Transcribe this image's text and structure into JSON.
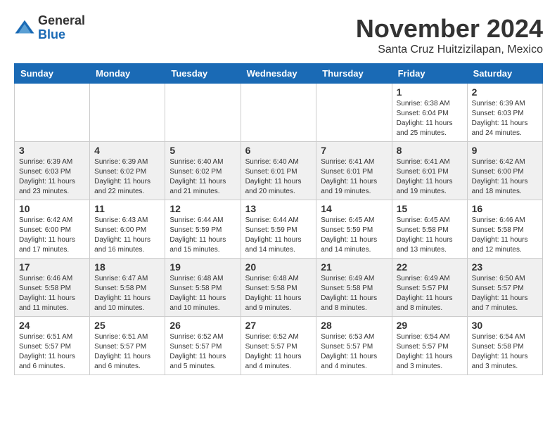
{
  "header": {
    "logo": {
      "general": "General",
      "blue": "Blue"
    },
    "month_year": "November 2024",
    "location": "Santa Cruz Huitzizilapan, Mexico"
  },
  "weekdays": [
    "Sunday",
    "Monday",
    "Tuesday",
    "Wednesday",
    "Thursday",
    "Friday",
    "Saturday"
  ],
  "weeks": [
    {
      "row_class": "week-row-1",
      "days": [
        {
          "number": "",
          "info": ""
        },
        {
          "number": "",
          "info": ""
        },
        {
          "number": "",
          "info": ""
        },
        {
          "number": "",
          "info": ""
        },
        {
          "number": "",
          "info": ""
        },
        {
          "number": "1",
          "info": "Sunrise: 6:38 AM\nSunset: 6:04 PM\nDaylight: 11 hours\nand 25 minutes."
        },
        {
          "number": "2",
          "info": "Sunrise: 6:39 AM\nSunset: 6:03 PM\nDaylight: 11 hours\nand 24 minutes."
        }
      ]
    },
    {
      "row_class": "week-row-2",
      "days": [
        {
          "number": "3",
          "info": "Sunrise: 6:39 AM\nSunset: 6:03 PM\nDaylight: 11 hours\nand 23 minutes."
        },
        {
          "number": "4",
          "info": "Sunrise: 6:39 AM\nSunset: 6:02 PM\nDaylight: 11 hours\nand 22 minutes."
        },
        {
          "number": "5",
          "info": "Sunrise: 6:40 AM\nSunset: 6:02 PM\nDaylight: 11 hours\nand 21 minutes."
        },
        {
          "number": "6",
          "info": "Sunrise: 6:40 AM\nSunset: 6:01 PM\nDaylight: 11 hours\nand 20 minutes."
        },
        {
          "number": "7",
          "info": "Sunrise: 6:41 AM\nSunset: 6:01 PM\nDaylight: 11 hours\nand 19 minutes."
        },
        {
          "number": "8",
          "info": "Sunrise: 6:41 AM\nSunset: 6:01 PM\nDaylight: 11 hours\nand 19 minutes."
        },
        {
          "number": "9",
          "info": "Sunrise: 6:42 AM\nSunset: 6:00 PM\nDaylight: 11 hours\nand 18 minutes."
        }
      ]
    },
    {
      "row_class": "week-row-3",
      "days": [
        {
          "number": "10",
          "info": "Sunrise: 6:42 AM\nSunset: 6:00 PM\nDaylight: 11 hours\nand 17 minutes."
        },
        {
          "number": "11",
          "info": "Sunrise: 6:43 AM\nSunset: 6:00 PM\nDaylight: 11 hours\nand 16 minutes."
        },
        {
          "number": "12",
          "info": "Sunrise: 6:44 AM\nSunset: 5:59 PM\nDaylight: 11 hours\nand 15 minutes."
        },
        {
          "number": "13",
          "info": "Sunrise: 6:44 AM\nSunset: 5:59 PM\nDaylight: 11 hours\nand 14 minutes."
        },
        {
          "number": "14",
          "info": "Sunrise: 6:45 AM\nSunset: 5:59 PM\nDaylight: 11 hours\nand 14 minutes."
        },
        {
          "number": "15",
          "info": "Sunrise: 6:45 AM\nSunset: 5:58 PM\nDaylight: 11 hours\nand 13 minutes."
        },
        {
          "number": "16",
          "info": "Sunrise: 6:46 AM\nSunset: 5:58 PM\nDaylight: 11 hours\nand 12 minutes."
        }
      ]
    },
    {
      "row_class": "week-row-4",
      "days": [
        {
          "number": "17",
          "info": "Sunrise: 6:46 AM\nSunset: 5:58 PM\nDaylight: 11 hours\nand 11 minutes."
        },
        {
          "number": "18",
          "info": "Sunrise: 6:47 AM\nSunset: 5:58 PM\nDaylight: 11 hours\nand 10 minutes."
        },
        {
          "number": "19",
          "info": "Sunrise: 6:48 AM\nSunset: 5:58 PM\nDaylight: 11 hours\nand 10 minutes."
        },
        {
          "number": "20",
          "info": "Sunrise: 6:48 AM\nSunset: 5:58 PM\nDaylight: 11 hours\nand 9 minutes."
        },
        {
          "number": "21",
          "info": "Sunrise: 6:49 AM\nSunset: 5:58 PM\nDaylight: 11 hours\nand 8 minutes."
        },
        {
          "number": "22",
          "info": "Sunrise: 6:49 AM\nSunset: 5:57 PM\nDaylight: 11 hours\nand 8 minutes."
        },
        {
          "number": "23",
          "info": "Sunrise: 6:50 AM\nSunset: 5:57 PM\nDaylight: 11 hours\nand 7 minutes."
        }
      ]
    },
    {
      "row_class": "week-row-5",
      "days": [
        {
          "number": "24",
          "info": "Sunrise: 6:51 AM\nSunset: 5:57 PM\nDaylight: 11 hours\nand 6 minutes."
        },
        {
          "number": "25",
          "info": "Sunrise: 6:51 AM\nSunset: 5:57 PM\nDaylight: 11 hours\nand 6 minutes."
        },
        {
          "number": "26",
          "info": "Sunrise: 6:52 AM\nSunset: 5:57 PM\nDaylight: 11 hours\nand 5 minutes."
        },
        {
          "number": "27",
          "info": "Sunrise: 6:52 AM\nSunset: 5:57 PM\nDaylight: 11 hours\nand 4 minutes."
        },
        {
          "number": "28",
          "info": "Sunrise: 6:53 AM\nSunset: 5:57 PM\nDaylight: 11 hours\nand 4 minutes."
        },
        {
          "number": "29",
          "info": "Sunrise: 6:54 AM\nSunset: 5:57 PM\nDaylight: 11 hours\nand 3 minutes."
        },
        {
          "number": "30",
          "info": "Sunrise: 6:54 AM\nSunset: 5:58 PM\nDaylight: 11 hours\nand 3 minutes."
        }
      ]
    }
  ]
}
